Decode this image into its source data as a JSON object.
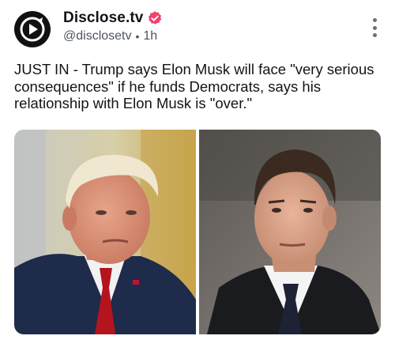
{
  "account": {
    "display_name": "Disclose.tv",
    "handle": "@disclosetv",
    "separator": "•",
    "time": "1h",
    "verified": true,
    "avatar_icon": "play-circle-logo-icon",
    "verified_icon": "verified-badge-icon",
    "verified_color": "#f0426c"
  },
  "post": {
    "text": "JUST IN - Trump says Elon Musk will face \"very serious consequences\" if he funds Democrats, says his relationship with Elon Musk is \"over.\""
  },
  "media": {
    "images": [
      {
        "subject": "Donald Trump portrait"
      },
      {
        "subject": "Elon Musk portrait"
      }
    ]
  },
  "menu": {
    "icon": "more-vertical-icon"
  }
}
